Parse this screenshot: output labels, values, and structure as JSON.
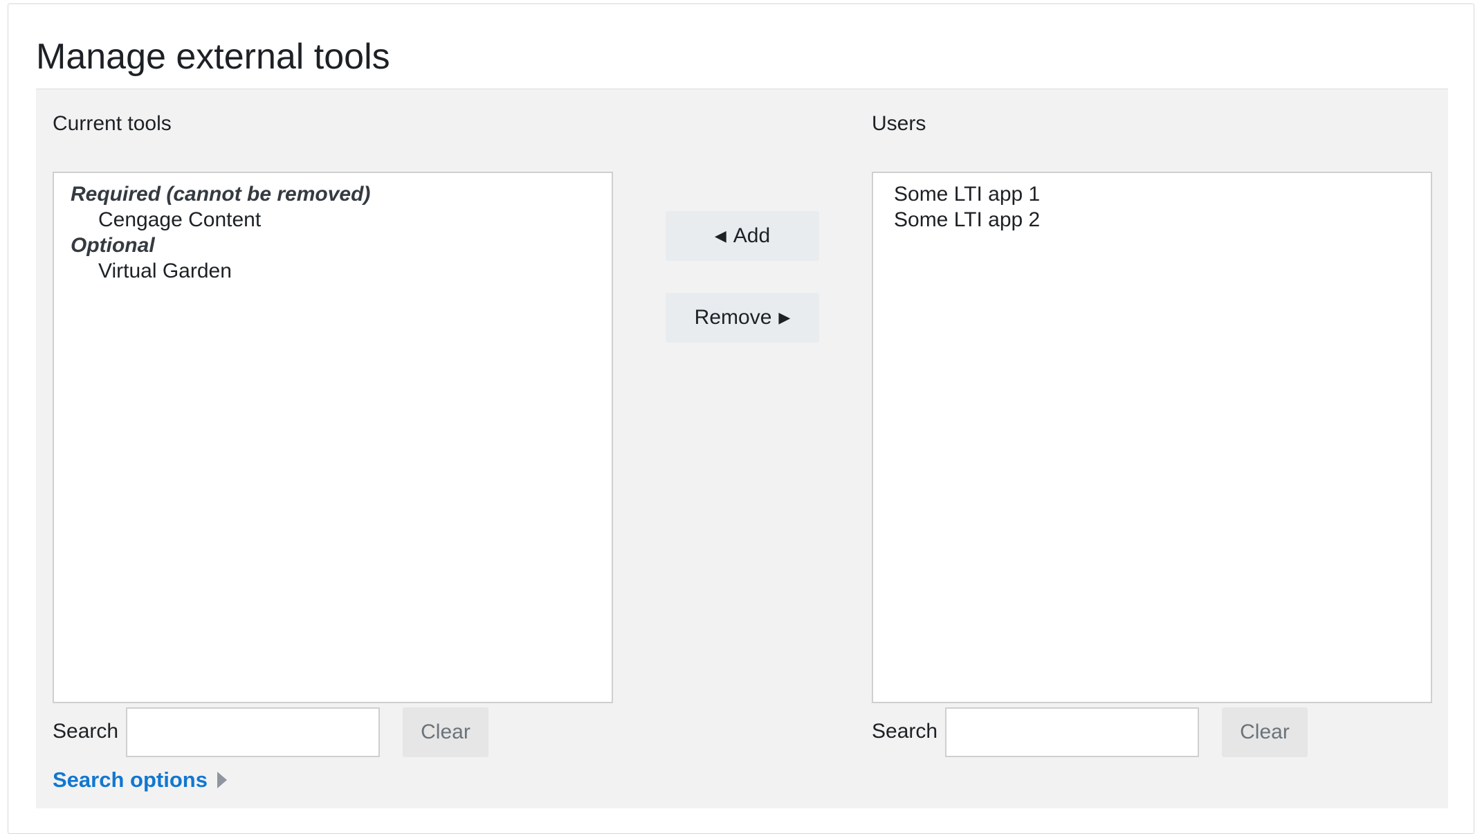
{
  "title": "Manage external tools",
  "left": {
    "label": "Current tools",
    "groups": [
      {
        "label": "Required (cannot be removed)",
        "items": [
          "Cengage Content"
        ]
      },
      {
        "label": "Optional",
        "items": [
          "Virtual Garden"
        ]
      }
    ],
    "search_label": "Search",
    "search_value": "",
    "clear_label": "Clear"
  },
  "right": {
    "label": "Users",
    "items": [
      "Some LTI app 1",
      "Some LTI app 2"
    ],
    "search_label": "Search",
    "search_value": "",
    "clear_label": "Clear"
  },
  "actions": {
    "add_arrow": "◀",
    "add_label": "Add",
    "remove_label": "Remove",
    "remove_arrow": "▶"
  },
  "search_options": {
    "label": "Search options",
    "icon": "caret-right-icon"
  },
  "colors": {
    "link": "#1177d1",
    "panel_bg": "#f2f2f2",
    "button_bg": "#e9ecef"
  }
}
